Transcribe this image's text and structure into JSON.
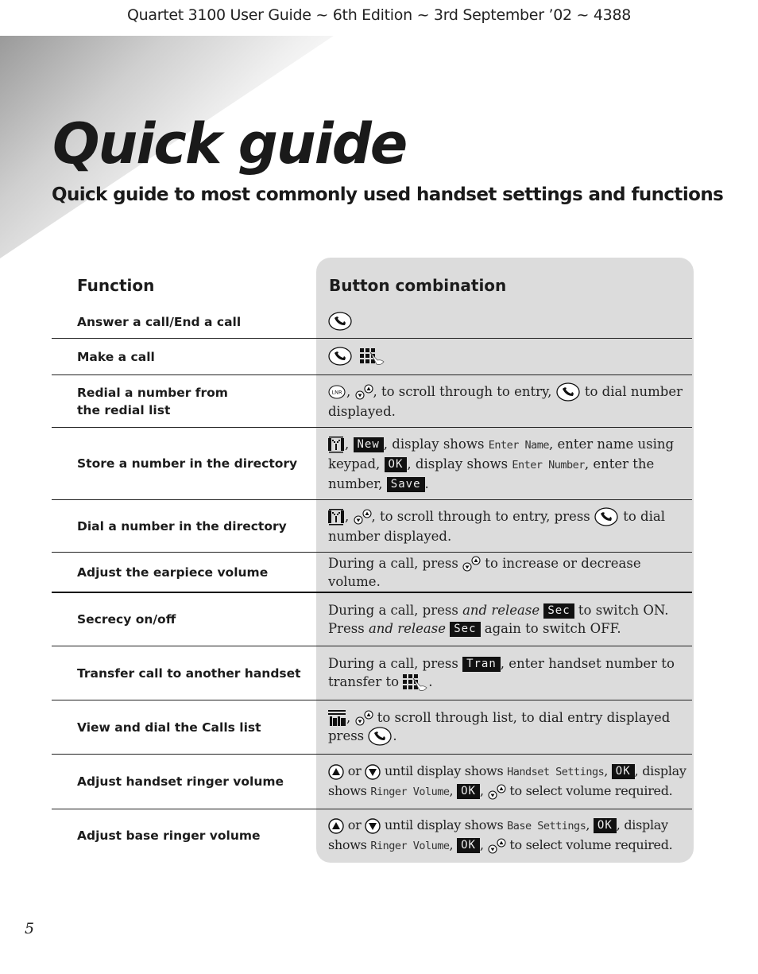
{
  "header": {
    "running_head": "Quartet 3100 User Guide ~ 6th Edition ~ 3rd September ’02 ~ 4388"
  },
  "title": "Quick guide",
  "subtitle": "Quick guide to most commonly used handset settings and functions",
  "table": {
    "col_function": "Function",
    "col_buttons": "Button combination",
    "rows": [
      {
        "function": "Answer a call/End a call"
      },
      {
        "function": "Make a call"
      },
      {
        "function": "Redial a number from the redial list",
        "t1": ", ",
        "t2": ", to scroll through to entry, ",
        "t3": " to dial number displayed."
      },
      {
        "function": "Store a number in the directory",
        "t1": ", ",
        "lcd1": "New",
        "t2": ", display shows ",
        "disp1": "Enter Name",
        "t3": ", enter name using keypad, ",
        "lcd2": "OK",
        "t4": ", display shows ",
        "disp2": "Enter Number",
        "t5": ", enter the number, ",
        "lcd3": "Save",
        "t6": "."
      },
      {
        "function": "Dial a number in the directory",
        "t1": ", ",
        "t2": ", to scroll through to entry, press ",
        "t3": " to dial number displayed."
      },
      {
        "function": "Adjust the earpiece volume",
        "t1": "During a call, press ",
        "t2": " to increase or decrease volume."
      },
      {
        "function": "Secrecy on/off",
        "t1": "During a call, press ",
        "em1": "and release",
        "lcd1": "Sec",
        "t2": " to switch ON.",
        "t3": "Press ",
        "em2": "and release",
        "lcd2": "Sec",
        "t4": " again to switch OFF."
      },
      {
        "function": "Transfer call to another handset",
        "t1": "During a call, press ",
        "lcd1": "Tran",
        "t2": ", enter handset number to transfer to ",
        "t3": "."
      },
      {
        "function": "View and dial the Calls list",
        "t1": ", ",
        "t2": " to scroll through list, to dial entry displayed press ",
        "t3": "."
      },
      {
        "function": "Adjust handset ringer volume",
        "or": " or ",
        "t1": " until display shows ",
        "disp1": "Handset Settings",
        "t2": ", ",
        "lcd1": "OK",
        "t3": ", display shows ",
        "disp2": "Ringer Volume",
        "t4": ", ",
        "lcd2": "OK",
        "t5": ", ",
        "t6": " to select volume required."
      },
      {
        "function": "Adjust base ringer volume",
        "or": " or ",
        "t1": " until display shows ",
        "disp1": "Base Settings",
        "t2": ", ",
        "lcd1": "OK",
        "t3": ", display shows ",
        "disp2": "Ringer Volume",
        "t4": ", ",
        "lcd2": "OK",
        "t5": ", ",
        "t6": " to select volume required."
      }
    ]
  },
  "icons": {
    "talk": "talk-button-icon",
    "keypad": "keypad-icon",
    "redial": "LNR",
    "scroll": "scroll-up-down-icon",
    "directory": "directory-icon",
    "calls_list": "calls-list-icon",
    "up": "up-arrow-icon",
    "down": "down-arrow-icon"
  },
  "page_number": "5"
}
